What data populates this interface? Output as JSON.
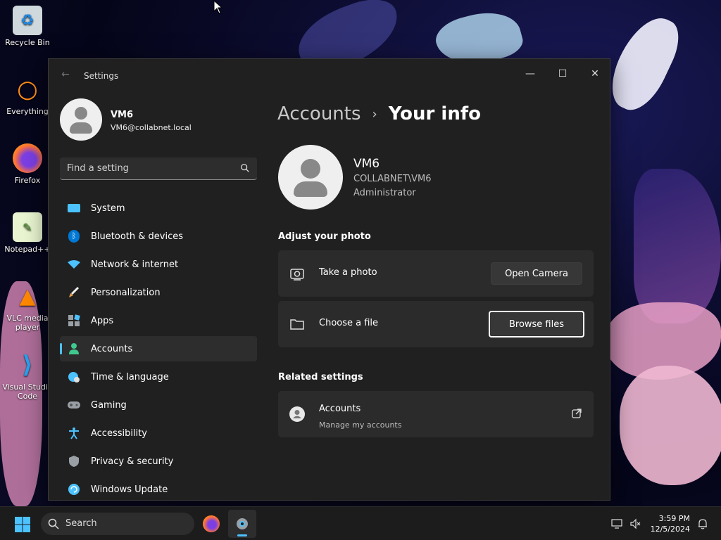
{
  "desktop": {
    "icons": [
      {
        "label": "Recycle Bin"
      },
      {
        "label": "Everything"
      },
      {
        "label": "Firefox"
      },
      {
        "label": "Notepad++"
      },
      {
        "label": "VLC media player"
      },
      {
        "label": "Visual Studio Code"
      }
    ]
  },
  "window": {
    "title": "Settings",
    "controls": {
      "minimize": "—",
      "maximize": "☐",
      "close": "✕"
    }
  },
  "profile": {
    "name": "VM6",
    "email": "VM6@collabnet.local"
  },
  "search": {
    "placeholder": "Find a setting"
  },
  "nav": {
    "items": [
      {
        "label": "System",
        "icon": "system-icon",
        "color": "#4cc2ff"
      },
      {
        "label": "Bluetooth & devices",
        "icon": "bluetooth-icon",
        "color": "#0078d4"
      },
      {
        "label": "Network & internet",
        "icon": "wifi-icon",
        "color": "#4cc2ff"
      },
      {
        "label": "Personalization",
        "icon": "brush-icon",
        "color": "#e8a44a"
      },
      {
        "label": "Apps",
        "icon": "apps-icon",
        "color": "#9aa0a6"
      },
      {
        "label": "Accounts",
        "icon": "person-icon",
        "color": "#3fc98e"
      },
      {
        "label": "Time & language",
        "icon": "globe-clock-icon",
        "color": "#4cc2ff"
      },
      {
        "label": "Gaming",
        "icon": "gamepad-icon",
        "color": "#9aa0a6"
      },
      {
        "label": "Accessibility",
        "icon": "accessibility-icon",
        "color": "#4cc2ff"
      },
      {
        "label": "Privacy & security",
        "icon": "shield-icon",
        "color": "#9aa0a6"
      },
      {
        "label": "Windows Update",
        "icon": "update-icon",
        "color": "#4cc2ff"
      }
    ],
    "active": "Accounts"
  },
  "main": {
    "breadcrumb": {
      "parent": "Accounts",
      "separator": "›",
      "current": "Your info"
    },
    "user": {
      "name": "VM6",
      "domain": "COLLABNET\\VM6",
      "role": "Administrator"
    },
    "adjust_photo": {
      "title": "Adjust your photo",
      "take_photo": {
        "label": "Take a photo",
        "button": "Open Camera"
      },
      "choose_file": {
        "label": "Choose a file",
        "button": "Browse files"
      }
    },
    "related": {
      "title": "Related settings",
      "accounts": {
        "title": "Accounts",
        "subtitle": "Manage my accounts"
      }
    }
  },
  "taskbar": {
    "search_placeholder": "Search",
    "time": "3:59 PM",
    "date": "12/5/2024"
  }
}
